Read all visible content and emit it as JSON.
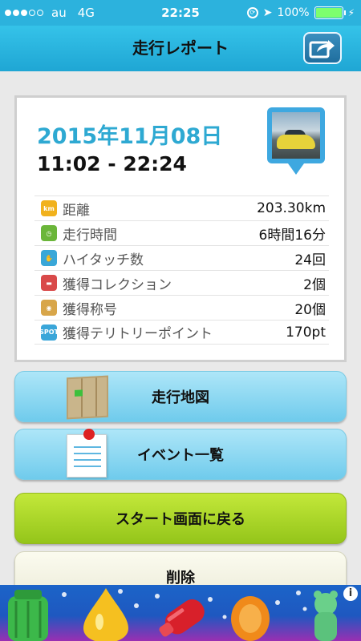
{
  "status_bar": {
    "carrier": "au",
    "network": "4G",
    "time": "22:25",
    "battery": "100%"
  },
  "header": {
    "title": "走行レポート",
    "share_icon": "share-icon"
  },
  "report": {
    "date": "2015年11月08日",
    "time_range": "11:02 - 22:24",
    "stats": [
      {
        "icon": "distance-icon",
        "icon_text": "km",
        "label": "距離",
        "value": "203.30km",
        "color": "#f1b21d"
      },
      {
        "icon": "clock-icon",
        "icon_text": "◷",
        "label": "走行時間",
        "value": "6時間16分",
        "color": "#6bb63a"
      },
      {
        "icon": "hand-icon",
        "icon_text": "✋",
        "label": "ハイタッチ数",
        "value": "24回",
        "color": "#39a7d8"
      },
      {
        "icon": "car-icon",
        "icon_text": "▬",
        "label": "獲得コレクション",
        "value": "2個",
        "color": "#d94a4a"
      },
      {
        "icon": "medal-icon",
        "icon_text": "◉",
        "label": "獲得称号",
        "value": "20個",
        "color": "#d8a64a"
      },
      {
        "icon": "spot-icon",
        "icon_text": "SPOT",
        "label": "獲得テリトリーポイント",
        "value": "170pt",
        "color": "#3aa6d9"
      }
    ]
  },
  "buttons": {
    "map": "走行地図",
    "events": "イベント一覧",
    "back_to_start": "スタート画面に戻る",
    "delete": "削除"
  },
  "ad": {
    "info_label": "i"
  }
}
